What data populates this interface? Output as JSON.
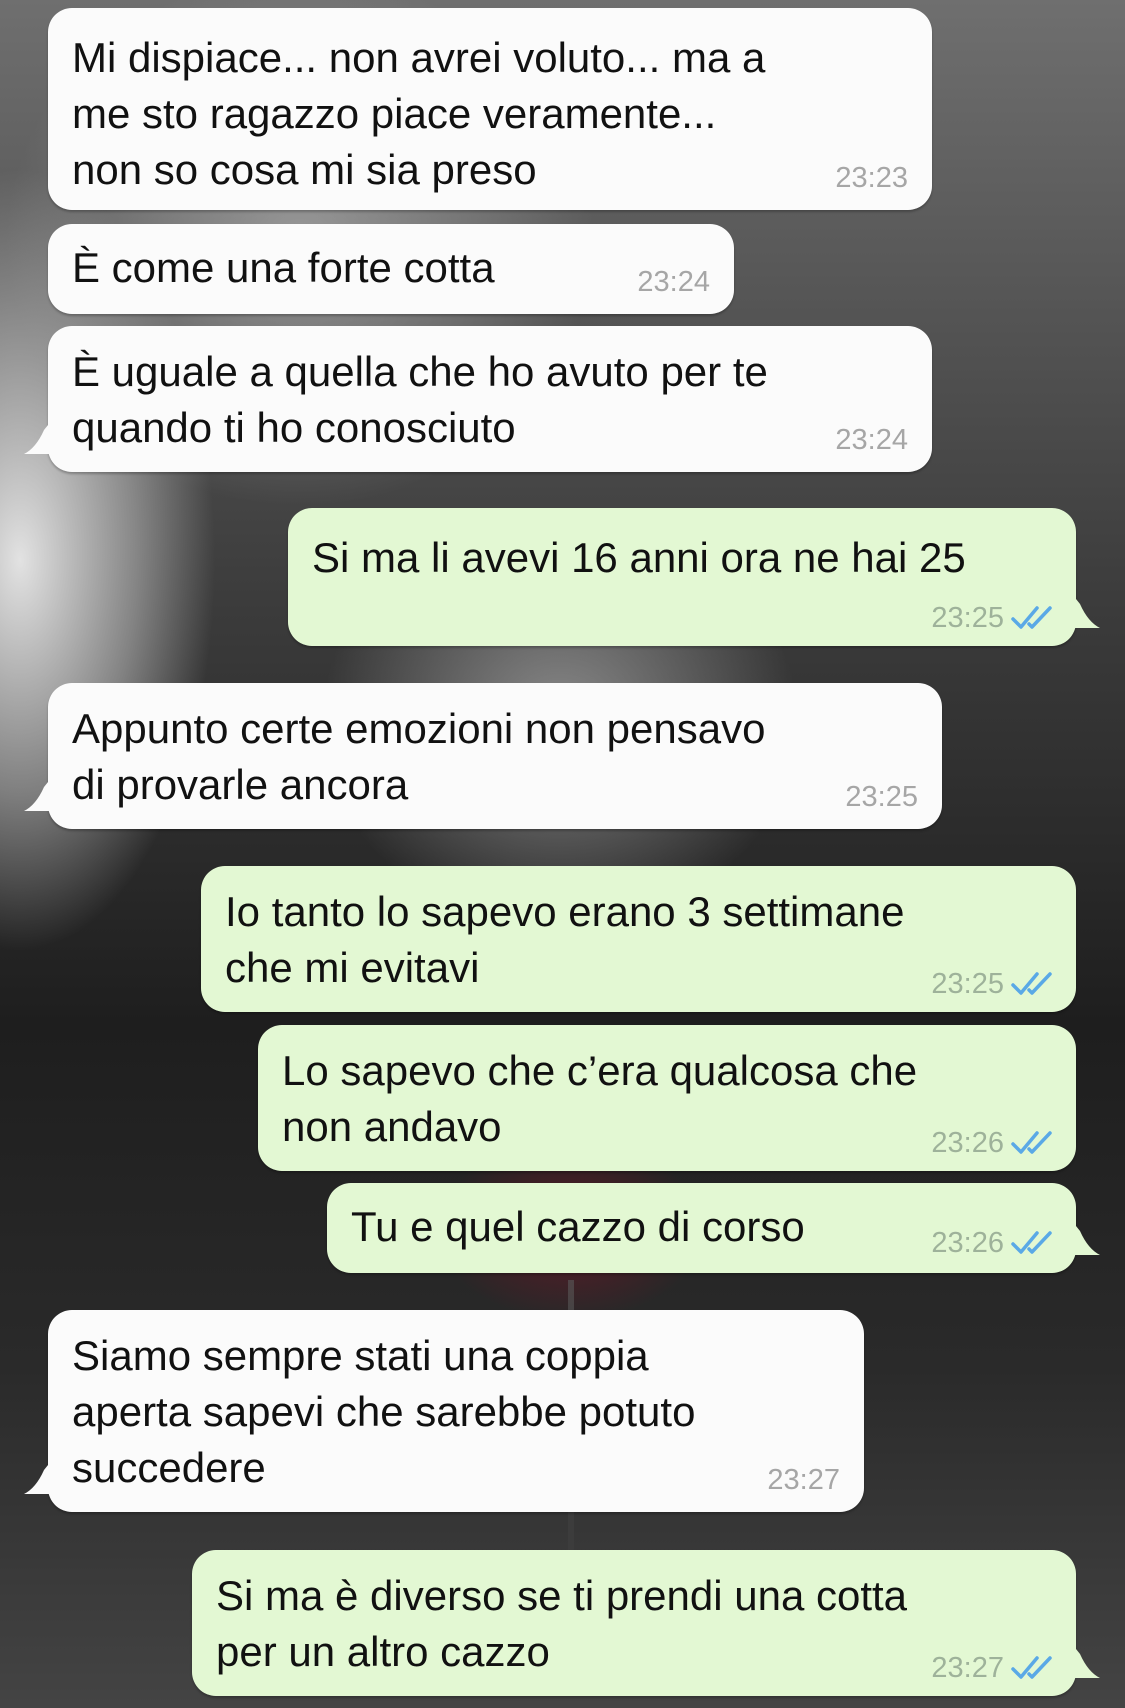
{
  "colors": {
    "incoming_bubble": "#fbfbfb",
    "outgoing_bubble": "#e3f8d3",
    "read_check": "#5aa9e6"
  },
  "messages": [
    {
      "direction": "in",
      "text": "Mi dispiace... non avrei voluto... ma a\nme sto ragazzo piace veramente...\nnon so cosa mi sia preso",
      "time": "23:23"
    },
    {
      "direction": "in",
      "text": "È come una forte cotta",
      "time": "23:24"
    },
    {
      "direction": "in",
      "text": "È uguale a quella che ho avuto per te\nquando ti ho conosciuto",
      "time": "23:24"
    },
    {
      "direction": "out",
      "text": "Si ma li avevi 16 anni ora ne hai 25",
      "time": "23:25",
      "status": "read"
    },
    {
      "direction": "in",
      "text": "Appunto certe emozioni non pensavo\ndi provarle ancora",
      "time": "23:25"
    },
    {
      "direction": "out",
      "text": "Io tanto lo sapevo erano 3 settimane\nche mi evitavi",
      "time": "23:25",
      "status": "read"
    },
    {
      "direction": "out",
      "text": "Lo sapevo che c’era qualcosa che\nnon andavo",
      "time": "23:26",
      "status": "read"
    },
    {
      "direction": "out",
      "text": "Tu e quel cazzo di corso",
      "time": "23:26",
      "status": "read"
    },
    {
      "direction": "in",
      "text": "Siamo sempre stati una coppia\naperta sapevi che sarebbe potuto\nsuccedere",
      "time": "23:27"
    },
    {
      "direction": "out",
      "text": "Si ma è diverso se ti prendi una cotta\nper un altro cazzo",
      "time": "23:27",
      "status": "read"
    }
  ]
}
